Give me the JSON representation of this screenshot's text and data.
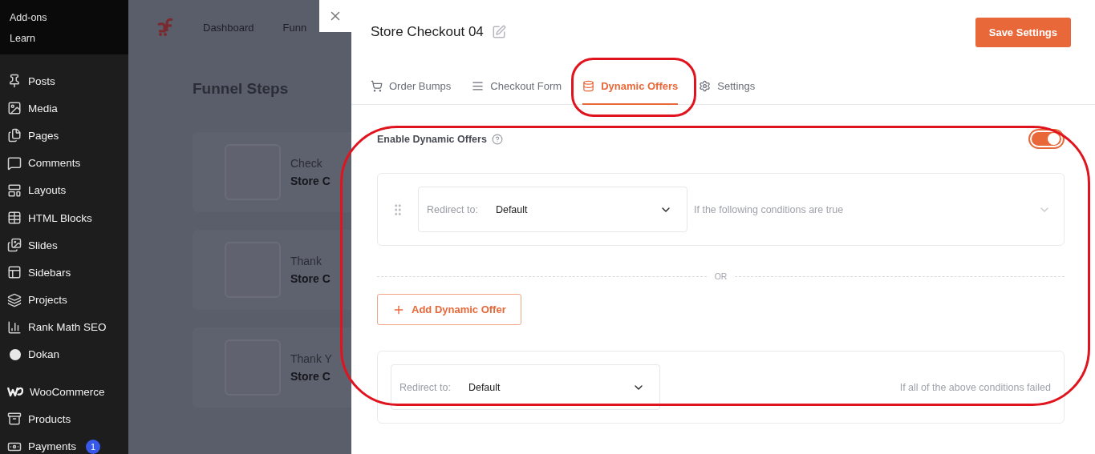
{
  "sidebar": {
    "top_items": [
      {
        "label": "Add-ons"
      },
      {
        "label": "Learn"
      }
    ],
    "groups": [
      [
        {
          "label": "Posts"
        },
        {
          "label": "Media"
        },
        {
          "label": "Pages"
        },
        {
          "label": "Comments"
        },
        {
          "label": "Layouts"
        },
        {
          "label": "HTML Blocks"
        },
        {
          "label": "Slides"
        },
        {
          "label": "Sidebars"
        },
        {
          "label": "Projects"
        },
        {
          "label": "Rank Math SEO"
        },
        {
          "label": "Dokan"
        }
      ],
      [
        {
          "label": "WooCommerce"
        },
        {
          "label": "Products"
        },
        {
          "label": "Payments",
          "badge": "1"
        }
      ]
    ]
  },
  "background_page": {
    "nav": [
      "Dashboard",
      "Funn"
    ],
    "title": "Funnel Steps",
    "steps": [
      {
        "type": "Check",
        "name": "Store C"
      },
      {
        "type": "Thank",
        "name": "Store C"
      },
      {
        "type": "Thank Y",
        "name": "Store C"
      }
    ]
  },
  "drawer": {
    "title": "Store Checkout 04",
    "save_button": "Save Settings",
    "tabs": [
      {
        "label": "Order Bumps",
        "selected": false
      },
      {
        "label": "Checkout Form",
        "selected": false
      },
      {
        "label": "Dynamic Offers",
        "selected": true
      },
      {
        "label": "Settings",
        "selected": false
      }
    ],
    "enable": {
      "label": "Enable Dynamic Offers",
      "on": true
    },
    "offers": [
      {
        "redirect_label": "Redirect to:",
        "value": "Default",
        "condition": "If the following conditions are true"
      }
    ],
    "separator": "OR",
    "add_button": "Add Dynamic Offer",
    "fallback": {
      "redirect_label": "Redirect to:",
      "value": "Default",
      "condition": "If all of the above conditions failed"
    }
  }
}
